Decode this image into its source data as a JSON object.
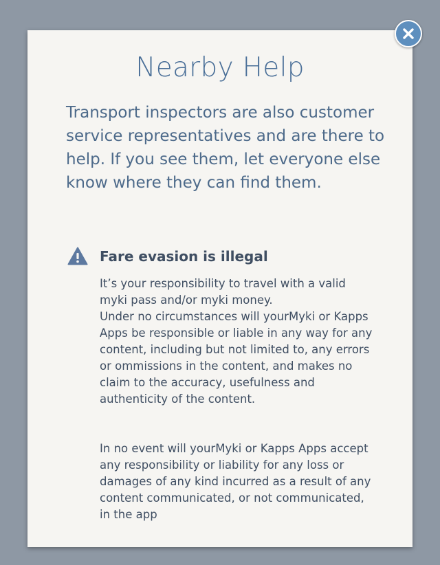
{
  "modal": {
    "title": "Nearby Help",
    "intro": "Transport inspectors are also customer service representatives and are there to help. If you see them, let everyone else know where they can find them.",
    "warning": {
      "icon": "warning-triangle-icon",
      "heading": "Fare evasion is illegal",
      "paragraph1_line1": "It’s your responsibility to travel with a valid myki pass and/or myki money.",
      "paragraph1_line2": "Under no circumstances will yourMyki or Kapps Apps be responsible or liable in any way for any content, including but not limited to, any errors or ommissions in the content, and makes no claim to the accuracy, usefulness and authenticity of the content.",
      "paragraph2": "In no event will yourMyki or Kapps Apps accept any responsibility or liability for any loss or damages of any kind incurred as a result of any content communicated, or not communicated, in the app"
    },
    "close_icon": "close-icon"
  },
  "colors": {
    "backdrop": "#8e98a4",
    "card": "#f6f5f2",
    "title": "#4a6f98",
    "body_text": "#3f4e62",
    "close_button": "#5e8fbe"
  }
}
